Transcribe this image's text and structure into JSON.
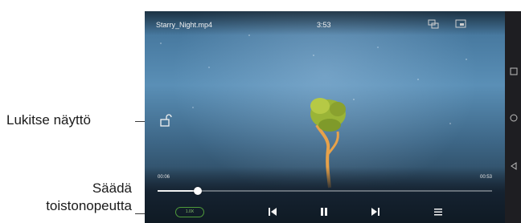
{
  "annotations": {
    "lock_label": "Lukitse näyttö",
    "speed_label_line1": "Säädä",
    "speed_label_line2": "toistonopeutta"
  },
  "player": {
    "title": "Starry_Night.mp4",
    "clock": "3:53",
    "elapsed": "00:06",
    "duration": "00:53",
    "progress": 0.12,
    "speed": "1.0X"
  },
  "colors": {
    "accent": "#4f9b3a",
    "bar_bg": "#1b1b1f"
  },
  "icons": [
    "screen-lock-icon",
    "mirror-icon",
    "cast-icon",
    "previous-icon",
    "pause-icon",
    "next-icon",
    "playlist-icon",
    "nav-square-icon",
    "nav-circle-icon",
    "nav-back-icon"
  ]
}
